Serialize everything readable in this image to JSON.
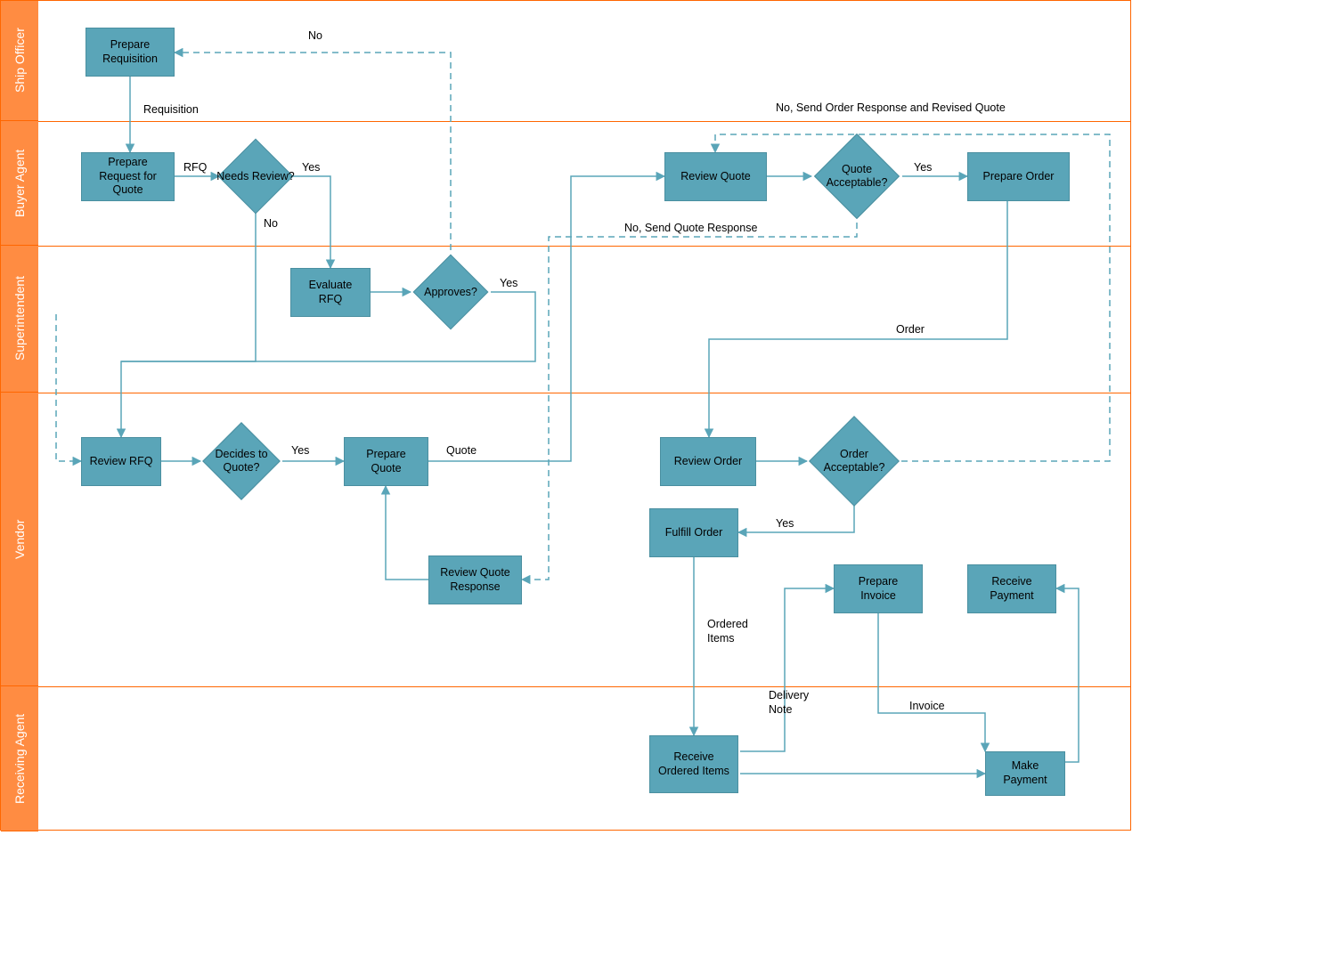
{
  "lanes": {
    "ship_officer": "Ship Officer",
    "buyer_agent": "Buyer Agent",
    "superintendent": "Superintendent",
    "vendor": "Vendor",
    "receiving_agent": "Receiving Agent"
  },
  "nodes": {
    "prepare_requisition": "Prepare Requisition",
    "prepare_rfq": "Prepare Request for Quote",
    "needs_review": "Needs Review?",
    "evaluate_rfq": "Evaluate RFQ",
    "approves": "Approves?",
    "review_rfq": "Review RFQ",
    "decides_to_quote": "Decides to Quote?",
    "prepare_quote": "Prepare Quote",
    "review_quote": "Review Quote",
    "quote_acceptable": "Quote Acceptable?",
    "prepare_order": "Prepare Order",
    "review_order": "Review Order",
    "order_acceptable": "Order Acceptable?",
    "fulfill_order": "Fulfill Order",
    "prepare_invoice": "Prepare Invoice",
    "receive_payment": "Receive Payment",
    "review_quote_response": "Review Quote Response",
    "receive_ordered_items": "Receive Ordered Items",
    "make_payment": "Make Payment"
  },
  "edges": {
    "requisition": "Requisition",
    "rfq": "RFQ",
    "yes1": "Yes",
    "no1": "No",
    "yes2": "Yes",
    "no2": "No",
    "yes3": "Yes",
    "quote": "Quote",
    "yes4": "Yes",
    "no_send_quote_resp": "No, Send Quote Response",
    "no_send_order_resp": "No,\nSend Order Response and Revised Quote",
    "order": "Order",
    "yes5": "Yes",
    "ordered_items": "Ordered Items",
    "delivery_note": "Delivery Note",
    "invoice": "Invoice"
  },
  "chart_data": {
    "type": "swimlane-flowchart",
    "lanes": [
      "Ship Officer",
      "Buyer Agent",
      "Superintendent",
      "Vendor",
      "Receiving Agent"
    ],
    "shapes": [
      {
        "id": "prepare_requisition",
        "type": "process",
        "lane": "Ship Officer",
        "label": "Prepare Requisition"
      },
      {
        "id": "prepare_rfq",
        "type": "process",
        "lane": "Buyer Agent",
        "label": "Prepare Request for Quote"
      },
      {
        "id": "needs_review",
        "type": "decision",
        "lane": "Buyer Agent",
        "label": "Needs Review?"
      },
      {
        "id": "evaluate_rfq",
        "type": "process",
        "lane": "Superintendent",
        "label": "Evaluate RFQ"
      },
      {
        "id": "approves",
        "type": "decision",
        "lane": "Superintendent",
        "label": "Approves?"
      },
      {
        "id": "review_rfq",
        "type": "process",
        "lane": "Vendor",
        "label": "Review RFQ"
      },
      {
        "id": "decides_to_quote",
        "type": "decision",
        "lane": "Vendor",
        "label": "Decides to Quote?"
      },
      {
        "id": "prepare_quote",
        "type": "process",
        "lane": "Vendor",
        "label": "Prepare Quote"
      },
      {
        "id": "review_quote",
        "type": "process",
        "lane": "Buyer Agent",
        "label": "Review Quote"
      },
      {
        "id": "quote_acceptable",
        "type": "decision",
        "lane": "Buyer Agent",
        "label": "Quote Acceptable?"
      },
      {
        "id": "prepare_order",
        "type": "process",
        "lane": "Buyer Agent",
        "label": "Prepare Order"
      },
      {
        "id": "review_order",
        "type": "process",
        "lane": "Vendor",
        "label": "Review Order"
      },
      {
        "id": "order_acceptable",
        "type": "decision",
        "lane": "Vendor",
        "label": "Order Acceptable?"
      },
      {
        "id": "fulfill_order",
        "type": "process",
        "lane": "Vendor",
        "label": "Fulfill Order"
      },
      {
        "id": "prepare_invoice",
        "type": "process",
        "lane": "Vendor",
        "label": "Prepare Invoice"
      },
      {
        "id": "receive_payment",
        "type": "process",
        "lane": "Vendor",
        "label": "Receive Payment"
      },
      {
        "id": "review_quote_response",
        "type": "process",
        "lane": "Vendor",
        "label": "Review Quote Response"
      },
      {
        "id": "receive_ordered_items",
        "type": "process",
        "lane": "Receiving Agent",
        "label": "Receive Ordered Items"
      },
      {
        "id": "make_payment",
        "type": "process",
        "lane": "Receiving Agent",
        "label": "Make Payment"
      }
    ],
    "flows": [
      {
        "from": "prepare_requisition",
        "to": "prepare_rfq",
        "label": "Requisition"
      },
      {
        "from": "prepare_rfq",
        "to": "needs_review",
        "label": "RFQ"
      },
      {
        "from": "needs_review",
        "to": "evaluate_rfq",
        "label": "Yes"
      },
      {
        "from": "needs_review",
        "to": "review_rfq",
        "label": "No"
      },
      {
        "from": "evaluate_rfq",
        "to": "approves"
      },
      {
        "from": "approves",
        "to": "review_rfq",
        "label": "Yes"
      },
      {
        "from": "approves",
        "to": "prepare_requisition",
        "label": "No",
        "style": "dashed"
      },
      {
        "from": "review_rfq",
        "to": "decides_to_quote"
      },
      {
        "from": "decides_to_quote",
        "to": "prepare_quote",
        "label": "Yes"
      },
      {
        "from": "prepare_quote",
        "to": "review_quote",
        "label": "Quote"
      },
      {
        "from": "review_quote",
        "to": "quote_acceptable"
      },
      {
        "from": "quote_acceptable",
        "to": "prepare_order",
        "label": "Yes"
      },
      {
        "from": "quote_acceptable",
        "to": "review_quote_response",
        "label": "No, Send Quote Response",
        "style": "dashed"
      },
      {
        "from": "review_quote_response",
        "to": "prepare_quote"
      },
      {
        "from": "prepare_order",
        "to": "review_order",
        "label": "Order"
      },
      {
        "from": "review_order",
        "to": "order_acceptable"
      },
      {
        "from": "order_acceptable",
        "to": "fulfill_order",
        "label": "Yes"
      },
      {
        "from": "order_acceptable",
        "to": "review_quote",
        "label": "No, Send Order Response and Revised Quote",
        "style": "dashed"
      },
      {
        "from": "fulfill_order",
        "to": "receive_ordered_items",
        "label": "Ordered Items"
      },
      {
        "from": "receive_ordered_items",
        "to": "prepare_invoice",
        "label": "Delivery Note"
      },
      {
        "from": "prepare_invoice",
        "to": "make_payment",
        "label": "Invoice"
      },
      {
        "from": "make_payment",
        "to": "receive_payment"
      },
      {
        "from": "receive_ordered_items",
        "to": "make_payment"
      }
    ]
  }
}
